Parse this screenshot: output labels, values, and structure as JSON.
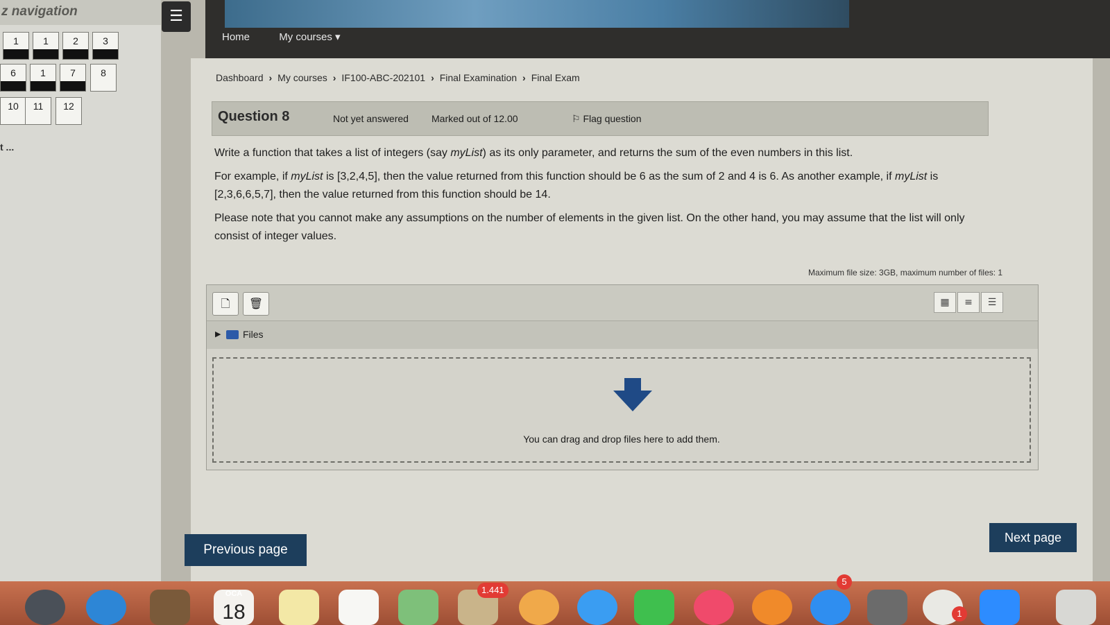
{
  "quiz_nav": {
    "title": "z navigation",
    "buttons": [
      {
        "label": "1",
        "answered": true
      },
      {
        "label": "1",
        "answered": true
      },
      {
        "label": "2",
        "answered": true
      },
      {
        "label": "3",
        "answered": true
      },
      {
        "label": "6",
        "answered": true
      },
      {
        "label": "1",
        "answered": true
      },
      {
        "label": "7",
        "answered": true
      },
      {
        "label": "8",
        "answered": false
      },
      {
        "label": "10",
        "answered": false
      },
      {
        "label": "11",
        "answered": false
      },
      {
        "label": "12",
        "answered": false
      }
    ],
    "more": "t ..."
  },
  "topnav": {
    "home": "Home",
    "courses": "My courses ▾"
  },
  "breadcrumb": [
    "Dashboard",
    "My courses",
    "IF100-ABC-202101",
    "Final Examination",
    "Final Exam"
  ],
  "question": {
    "title": "Question 8",
    "state": "Not yet answered",
    "marks": "Marked out of 12.00",
    "flag": "Flag question",
    "p1_pre": "Write a function that takes a list of integers (say ",
    "var": "myList",
    "p1_post": ") as its only parameter, and returns the sum of the even numbers in this list.",
    "p2_pre": "For example, if ",
    "p2_mid": " is [3,2,4,5], then the value returned from this function should be 6 as the sum of 2 and 4 is 6. As another example, if ",
    "p2_post": " is [2,3,6,6,5,7], then the value returned from this function should be 14.",
    "p3": "Please note that you cannot make any assumptions on the number of elements in the given list. On the other hand, you may assume that the list will only consist of integer values."
  },
  "filemanager": {
    "limits": "Maximum file size: 3GB, maximum number of files: 1",
    "folder": "Files",
    "drop_message": "You can drag and drop files here to add them."
  },
  "buttons": {
    "previous": "Previous page",
    "next": "Next page"
  },
  "dock": {
    "calendar_month": "OCA",
    "calendar_day": "18",
    "mail_badge": "1.441",
    "appstore_badge": "5",
    "chrome_badge": "1"
  },
  "colors": {
    "accent": "#1d3e5c",
    "page_bg": "#dcdbd3",
    "dock": "#b8603f"
  }
}
